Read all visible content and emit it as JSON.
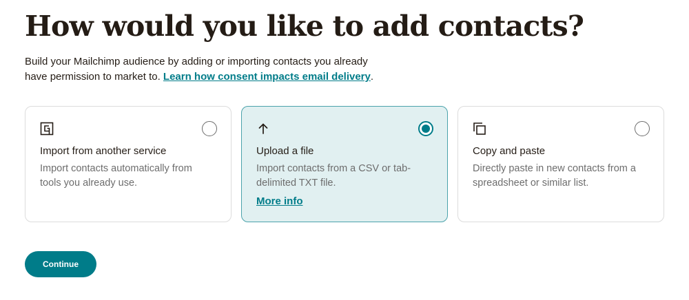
{
  "page": {
    "title": "How would you like to add contacts?",
    "intro_text": "Build your Mailchimp audience by adding or importing contacts you already have permission to market to. ",
    "intro_link": "Learn how consent impacts email delivery",
    "intro_end": "."
  },
  "options": [
    {
      "icon": "import-service-icon",
      "title": "Import from another service",
      "description": "Import contacts automatically from tools you already use.",
      "selected": false
    },
    {
      "icon": "upload-arrow-icon",
      "title": "Upload a file",
      "description": "Import contacts from a CSV or tab-delimited TXT file.",
      "link": "More info",
      "selected": true
    },
    {
      "icon": "copy-icon",
      "title": "Copy and paste",
      "description": "Directly paste in new contacts from a spreadsheet or similar list.",
      "selected": false
    }
  ],
  "actions": {
    "continue_label": "Continue"
  },
  "colors": {
    "accent": "#007c89",
    "selected_bg": "#e1f0f1",
    "text": "#241c15"
  }
}
